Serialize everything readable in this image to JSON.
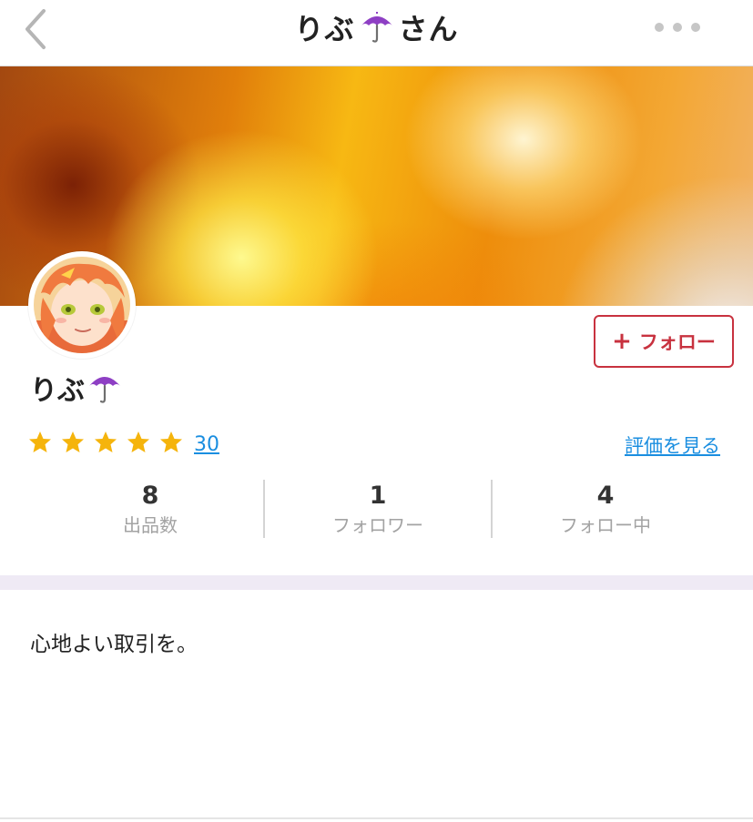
{
  "nav": {
    "title_name": "りぶ",
    "title_suffix": "さん",
    "back_icon": "chevron-left-icon",
    "more_icon": "more-horizontal-icon"
  },
  "profile": {
    "name": "りぶ",
    "name_emoji_icon": "umbrella-icon",
    "follow_label": "フォロー",
    "follow_plus": "+",
    "bio": "心地よい取引を。"
  },
  "rating": {
    "stars": 5,
    "count": "30",
    "view_label": "評価を見る"
  },
  "stats": [
    {
      "value": "8",
      "label": "出品数"
    },
    {
      "value": "1",
      "label": "フォロワー"
    },
    {
      "value": "4",
      "label": "フォロー中"
    }
  ],
  "colors": {
    "accent_red": "#c8323f",
    "link_blue": "#1a8ee0",
    "star_yellow": "#f5b40c",
    "section_gap": "#efeaf5"
  }
}
